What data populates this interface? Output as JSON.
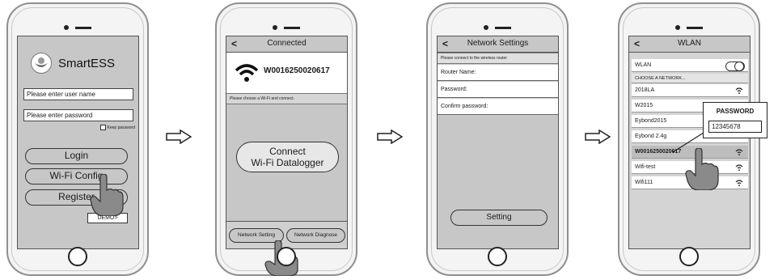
{
  "screen1": {
    "app_name": "SmartESS",
    "username_placeholder": "Please enter user name",
    "password_placeholder": "Please enter password",
    "keep_password": "Keep password",
    "login": "Login",
    "wifi_config": "Wi-Fi Config",
    "register": "Register",
    "demo": "DEMO>"
  },
  "screen2": {
    "title": "Connected",
    "back": "<",
    "ssid": "W0016250020617",
    "hint": "Please choose a Wi-Fi and connect.",
    "connect_line1": "Connect",
    "connect_line2": "Wi-Fi Datalogger",
    "network_setting": "Network Setting",
    "network_diagnose": "Network Diagnose"
  },
  "screen3": {
    "title": "Network Settings",
    "back": "<",
    "hint": "Please connect to the wireless router",
    "router_name": "Router Name:",
    "password": "Password:",
    "confirm_password": "Confirm password:",
    "setting": "Setting"
  },
  "screen4": {
    "title": "WLAN",
    "back": "<",
    "wlan_label": "WLAN",
    "choose": "CHOOSE A NETWORK...",
    "networks": [
      "2018LA",
      "W2015",
      "Eybond2015",
      "Eybond 2.4g",
      "W0016250020617",
      "Wifi-test",
      "Wifi111"
    ],
    "password_title": "PASSWORD",
    "password_value": "12345678"
  }
}
